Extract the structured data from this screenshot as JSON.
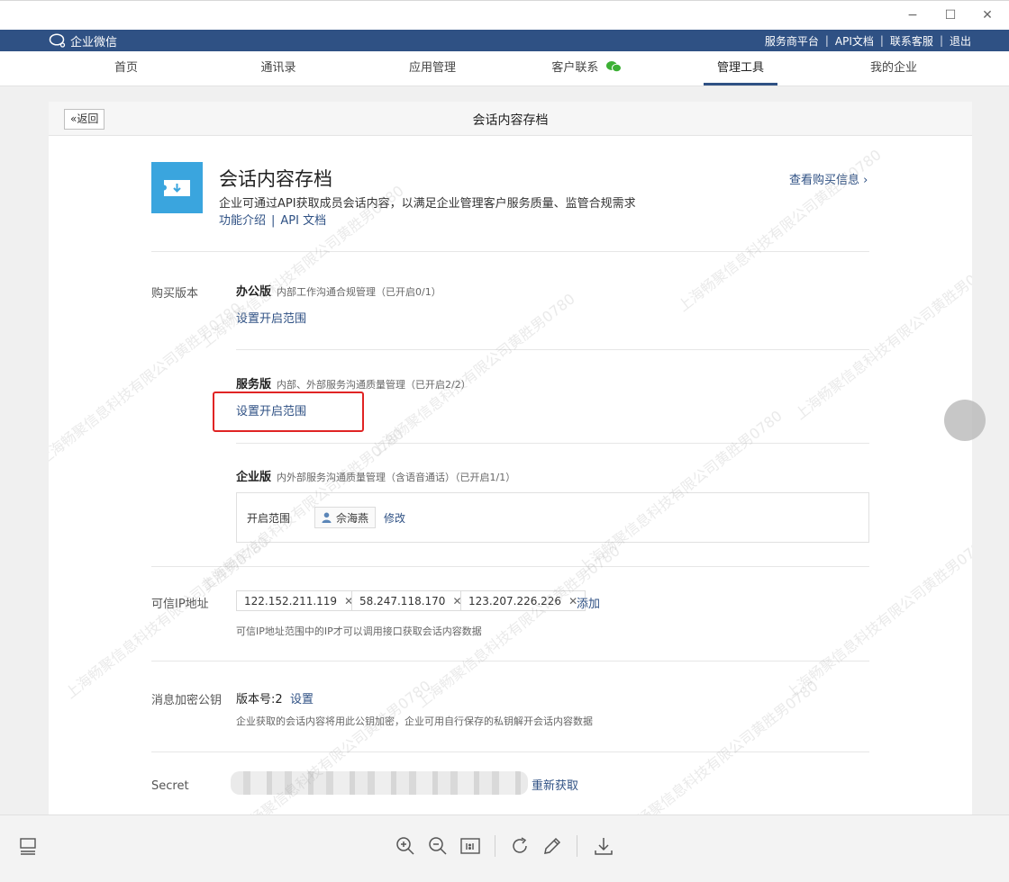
{
  "window": {
    "minimize": "−",
    "maximize": "☐",
    "close": "✕"
  },
  "appbar": {
    "logo_text": "企业微信",
    "links": [
      "服务商平台",
      "API文档",
      "联系客服",
      "退出"
    ]
  },
  "nav": {
    "items": [
      "首页",
      "通讯录",
      "应用管理",
      "客户联系",
      "管理工具",
      "我的企业"
    ],
    "active": "管理工具"
  },
  "panel": {
    "back_label": "«返回",
    "title": "会话内容存档"
  },
  "app": {
    "name": "会话内容存档",
    "description": "企业可通过API获取成员会话内容，以满足企业管理客户服务质量、监管合规需求",
    "link_intro": "功能介绍",
    "link_sep": "|",
    "link_api": "API 文档",
    "buy_info": "查看购买信息 ›"
  },
  "purchase": {
    "label": "购买版本",
    "editions": [
      {
        "name": "办公版",
        "desc": "内部工作沟通合规管理（已开启0/1）",
        "action": "设置开启范围"
      },
      {
        "name": "服务版",
        "desc": "内部、外部服务沟通质量管理（已开启2/2）",
        "action": "设置开启范围"
      },
      {
        "name": "企业版",
        "desc": "内外部服务沟通质量管理（含语音通话）（已开启1/1）"
      }
    ],
    "range": {
      "label": "开启范围",
      "member": "佘海燕",
      "modify": "修改"
    }
  },
  "trusted_ip": {
    "label": "可信IP地址",
    "ips": [
      "122.152.211.119",
      "58.247.118.170",
      "123.207.226.226"
    ],
    "remove": "✕",
    "add": "添加",
    "hint": "可信IP地址范围中的IP才可以调用接口获取会话内容数据"
  },
  "encryption": {
    "label": "消息加密公钥",
    "version": "版本号:2",
    "set": "设置",
    "hint": "企业获取的会话内容将用此公钥加密，企业可用自行保存的私钥解开会话内容数据"
  },
  "secret": {
    "label": "Secret",
    "refresh": "重新获取"
  },
  "watermark_text": "上海畅聚信息科技有限公司黄胜男0780"
}
